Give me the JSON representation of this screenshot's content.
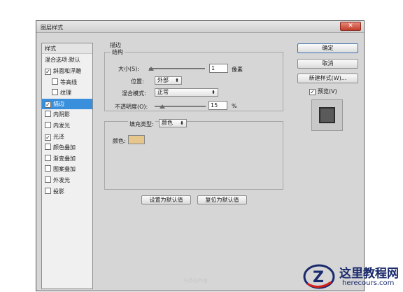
{
  "window": {
    "title": "图层样式",
    "close_label": "✕"
  },
  "styles_list": {
    "header": "样式",
    "blending": "混合选项:默认",
    "items": [
      {
        "label": "斜面和浮雕",
        "checked": true,
        "indent": false,
        "selected": false
      },
      {
        "label": "等高线",
        "checked": false,
        "indent": true,
        "selected": false
      },
      {
        "label": "纹理",
        "checked": false,
        "indent": true,
        "selected": false
      },
      {
        "label": "描边",
        "checked": true,
        "indent": false,
        "selected": true
      },
      {
        "label": "内阴影",
        "checked": false,
        "indent": false,
        "selected": false
      },
      {
        "label": "内发光",
        "checked": false,
        "indent": false,
        "selected": false
      },
      {
        "label": "光泽",
        "checked": true,
        "indent": false,
        "selected": false
      },
      {
        "label": "颜色叠加",
        "checked": false,
        "indent": false,
        "selected": false
      },
      {
        "label": "渐变叠加",
        "checked": false,
        "indent": false,
        "selected": false
      },
      {
        "label": "图案叠加",
        "checked": false,
        "indent": false,
        "selected": false
      },
      {
        "label": "外发光",
        "checked": false,
        "indent": false,
        "selected": false
      },
      {
        "label": "投影",
        "checked": false,
        "indent": false,
        "selected": false
      }
    ]
  },
  "stroke": {
    "section_title": "描边",
    "structure_label": "结构",
    "size_label": "大小(S):",
    "size_value": "1",
    "size_unit": "像素",
    "position_label": "位置:",
    "position_value": "外部",
    "blend_label": "混合模式:",
    "blend_value": "正常",
    "opacity_label": "不透明度(O):",
    "opacity_value": "15",
    "opacity_unit": "%",
    "fill_type_label": "填充类型:",
    "fill_type_value": "颜色",
    "color_label": "颜色:",
    "color_hex": "#e6c68b",
    "make_default": "设置为默认值",
    "reset_default": "复位为默认值"
  },
  "right": {
    "ok": "确定",
    "cancel": "取消",
    "new_style": "新建样式(W)...",
    "preview_label": "预览(V)",
    "preview_checked": true
  },
  "watermark": {
    "text1": "这里教程网",
    "text2": "herecours.com",
    "faint": "头条@作者"
  }
}
